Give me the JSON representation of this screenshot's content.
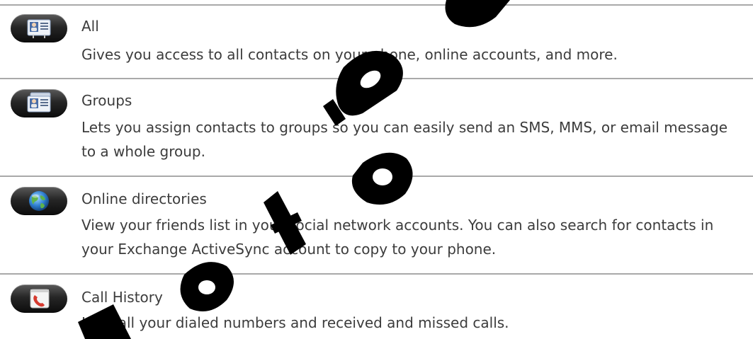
{
  "items": [
    {
      "icon": "contact-card-icon",
      "title": "All",
      "description": "Gives you access to all contacts on your phone, online accounts, and more."
    },
    {
      "icon": "contact-cards-stack-icon",
      "title": "Groups",
      "description": "Lets you assign contacts to groups so you can easily send an SMS, MMS, or email message to a whole group."
    },
    {
      "icon": "globe-icon",
      "title": "Online directories",
      "description": "View your friends list in your social network accounts. You can also search for contacts in your Exchange ActiveSync account to copy to your phone."
    },
    {
      "icon": "call-history-icon",
      "title": "Call History",
      "description": "Lists all your dialed numbers and received and missed calls."
    }
  ],
  "colors": {
    "text": "#3c3c3c",
    "rule": "#a9a9a9",
    "watermark": "#000000"
  }
}
